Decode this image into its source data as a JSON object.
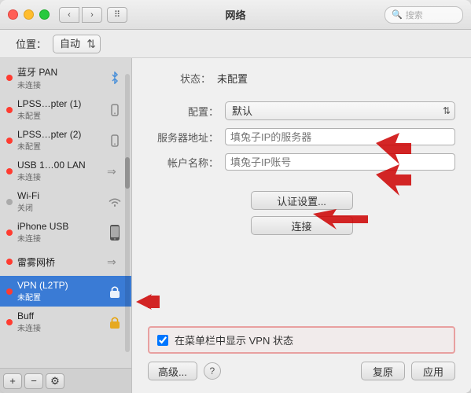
{
  "window": {
    "title": "网络",
    "search_placeholder": "搜索"
  },
  "location": {
    "label": "位置：",
    "value": "自动"
  },
  "sidebar": {
    "items": [
      {
        "id": "bluetooth",
        "name": "蓝牙 PAN",
        "status": "未连接",
        "dot": "red",
        "icon": "bluetooth"
      },
      {
        "id": "lpss1",
        "name": "LPSS…pter (1)",
        "status": "未配置",
        "dot": "red",
        "icon": "phone"
      },
      {
        "id": "lpss2",
        "name": "LPSS…pter (2)",
        "status": "未配置",
        "dot": "red",
        "icon": "phone"
      },
      {
        "id": "usb",
        "name": "USB 1…00 LAN",
        "status": "未连接",
        "dot": "red",
        "icon": "arrow"
      },
      {
        "id": "wifi",
        "name": "Wi-Fi",
        "status": "关闭",
        "dot": "gray",
        "icon": "wifi"
      },
      {
        "id": "iphone-usb",
        "name": "iPhone USB",
        "status": "未连接",
        "dot": "red",
        "icon": "iphone"
      },
      {
        "id": "thunder",
        "name": "雷雾网桥",
        "status": "",
        "dot": "red",
        "icon": "thunder"
      },
      {
        "id": "vpn",
        "name": "VPN (L2TP)",
        "status": "未配置",
        "dot": "red",
        "icon": "lock",
        "selected": true
      },
      {
        "id": "buff",
        "name": "Buff",
        "status": "未连接",
        "dot": "red",
        "icon": "lock2"
      }
    ],
    "toolbar": {
      "add": "+",
      "remove": "−",
      "gear": "⚙"
    }
  },
  "right_panel": {
    "status_label": "状态：",
    "status_value": "未配置",
    "config_label": "配置：",
    "config_value": "默认",
    "server_label": "服务器地址：",
    "server_placeholder": "填兔子IP的服务器",
    "account_label": "帐户名称：",
    "account_placeholder": "填兔子IP账号",
    "auth_button": "认证设置...",
    "connect_button": "连接",
    "checkbox_label": "在菜单栏中显示 VPN 状态",
    "checkbox_checked": true,
    "advanced_button": "高级...",
    "question_button": "?",
    "revert_button": "复原",
    "apply_button": "应用"
  }
}
